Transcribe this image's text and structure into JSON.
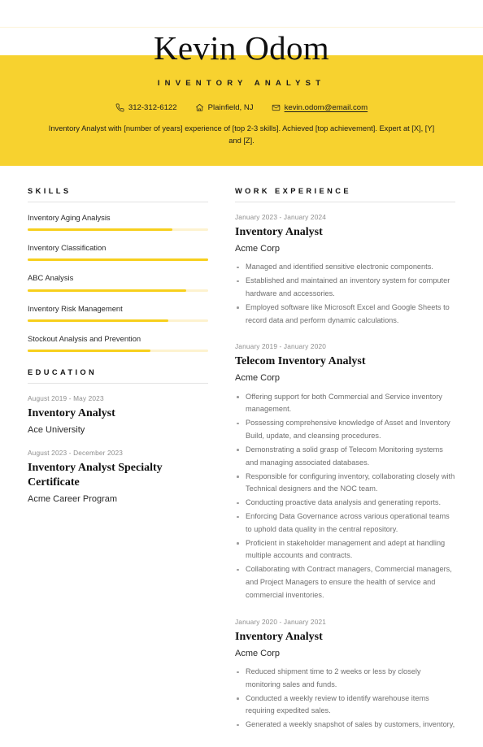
{
  "theme": {
    "accent": "#f7d22f",
    "accent_bar": "#f7cf1c",
    "accent_track": "#fdf2cf",
    "text": "#2b2b2b",
    "muted": "#6f6f6f",
    "date": "#8e8e8e"
  },
  "header": {
    "name": "Kevin Odom",
    "job_title": "Inventory Analyst",
    "contacts": [
      {
        "icon": "phone-icon",
        "text": "312-312-6122",
        "type": "phone"
      },
      {
        "icon": "location-icon",
        "text": "Plainfield, NJ",
        "type": "location"
      },
      {
        "icon": "email-icon",
        "text": "kevin.odom@email.com",
        "type": "email"
      }
    ],
    "summary": "Inventory Analyst with [number of years] experience of [top 2-3 skills]. Achieved [top achievement]. Expert at [X], [Y] and [Z]."
  },
  "skills": {
    "heading": "SKILLS",
    "items": [
      {
        "name": "Inventory Aging Analysis",
        "level": 80
      },
      {
        "name": "Inventory Classification",
        "level": 100
      },
      {
        "name": "ABC Analysis",
        "level": 88
      },
      {
        "name": "Inventory Risk Management",
        "level": 78
      },
      {
        "name": "Stockout Analysis and Prevention",
        "level": 68
      }
    ]
  },
  "education": {
    "heading": "EDUCATION",
    "entries": [
      {
        "date": "August 2019 - May 2023",
        "title": "Inventory Analyst",
        "org": "Ace University"
      },
      {
        "date": "August 2023 - December 2023",
        "title": "Inventory Analyst Specialty Certificate",
        "org": "Acme Career Program"
      }
    ]
  },
  "work_experience": {
    "heading": "WORK EXPERIENCE",
    "entries": [
      {
        "date": "January 2023 - January 2024",
        "title": "Inventory Analyst",
        "org": "Acme Corp",
        "bullets": [
          "Managed and identified sensitive electronic components.",
          "Established and maintained an inventory system for computer hardware and accessories.",
          "Employed software like Microsoft Excel and Google Sheets to record data and perform dynamic calculations."
        ]
      },
      {
        "date": "January 2019 - January 2020",
        "title": "Telecom Inventory Analyst",
        "org": "Acme Corp",
        "bullets": [
          "Offering support for both Commercial and Service inventory management.",
          "Possessing comprehensive knowledge of Asset and Inventory Build, update, and cleansing procedures.",
          "Demonstrating a solid grasp of Telecom Monitoring systems and managing associated databases.",
          "Responsible for configuring inventory, collaborating closely with Technical designers and the NOC team.",
          "Conducting proactive data analysis and generating reports.",
          "Enforcing Data Governance across various operational teams to uphold data quality in the central repository.",
          "Proficient in stakeholder management and adept at handling multiple accounts and contracts.",
          "Collaborating with Contract managers, Commercial managers, and Project Managers to ensure the health of service and commercial inventories."
        ]
      },
      {
        "date": "January 2020 - January 2021",
        "title": "Inventory Analyst",
        "org": "Acme Corp",
        "bullets": [
          "Reduced shipment time to 2 weeks or less by closely monitoring sales and funds.",
          "Conducted a weekly review to identify warehouse items requiring expedited sales.",
          "Generated a weekly snapshot of sales by customers, inventory,"
        ]
      }
    ]
  }
}
